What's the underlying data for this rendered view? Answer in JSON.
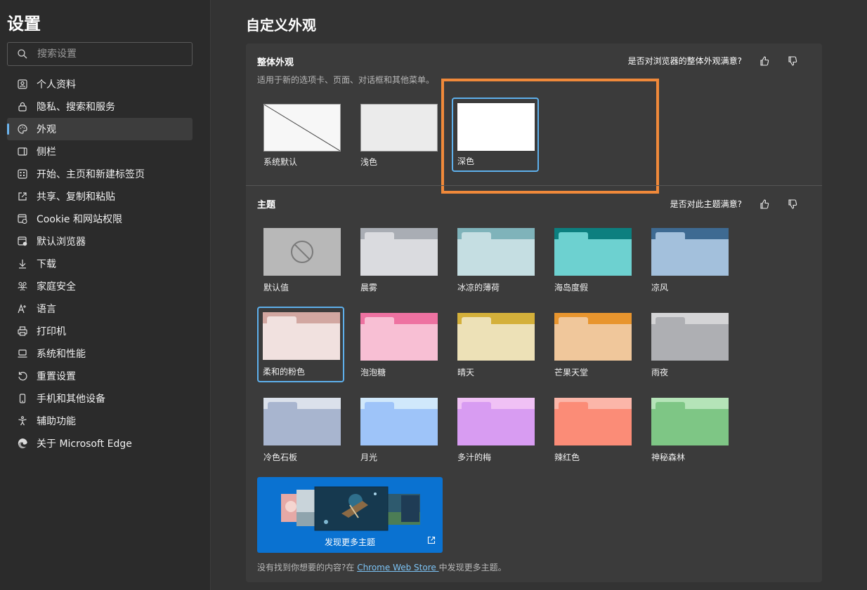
{
  "sidebar": {
    "title": "设置",
    "search_placeholder": "搜索设置",
    "items": [
      {
        "label": "个人资料",
        "icon": "profile-icon"
      },
      {
        "label": "隐私、搜索和服务",
        "icon": "lock-icon"
      },
      {
        "label": "外观",
        "icon": "palette-icon",
        "active": true
      },
      {
        "label": "侧栏",
        "icon": "sidebar-icon"
      },
      {
        "label": "开始、主页和新建标签页",
        "icon": "home-grid-icon"
      },
      {
        "label": "共享、复制和粘贴",
        "icon": "share-icon"
      },
      {
        "label": "Cookie 和网站权限",
        "icon": "cookie-icon"
      },
      {
        "label": "默认浏览器",
        "icon": "browser-icon"
      },
      {
        "label": "下载",
        "icon": "download-icon"
      },
      {
        "label": "家庭安全",
        "icon": "family-icon"
      },
      {
        "label": "语言",
        "icon": "language-icon"
      },
      {
        "label": "打印机",
        "icon": "printer-icon"
      },
      {
        "label": "系统和性能",
        "icon": "laptop-icon"
      },
      {
        "label": "重置设置",
        "icon": "reset-icon"
      },
      {
        "label": "手机和其他设备",
        "icon": "phone-icon"
      },
      {
        "label": "辅助功能",
        "icon": "accessibility-icon"
      },
      {
        "label": "关于 Microsoft Edge",
        "icon": "edge-logo-icon"
      }
    ]
  },
  "main": {
    "title": "自定义外观",
    "overall": {
      "title": "整体外观",
      "description": "适用于新的选项卡、页面、对话框和其他菜单。",
      "feedback": "是否对浏览器的整体外观满意?",
      "modes": [
        {
          "label": "系统默认"
        },
        {
          "label": "浅色"
        },
        {
          "label": "深色",
          "selected": true
        }
      ]
    },
    "themes": {
      "title": "主题",
      "feedback": "是否对此主题满意?",
      "items": [
        {
          "label": "默认值",
          "bar": "#b8b8b8",
          "body": "#b8b8b8",
          "tab": "#b8b8b8"
        },
        {
          "label": "晨雾",
          "bar": "#a9adb4",
          "body": "#dadbdf",
          "tab": "#dadbdf"
        },
        {
          "label": "冰凉的薄荷",
          "bar": "#7fb3ba",
          "body": "#c5dee2",
          "tab": "#c5dee2"
        },
        {
          "label": "海岛度假",
          "bar": "#0c7f7f",
          "body": "#6dd1d0",
          "tab": "#6dd1d0"
        },
        {
          "label": "凉风",
          "bar": "#3e6a92",
          "body": "#a3c0dc",
          "tab": "#a3c0dc"
        },
        {
          "label": "柔和的粉色",
          "bar": "#d2a7a1",
          "body": "#f1e1df",
          "tab": "#f1e1df",
          "selected": true
        },
        {
          "label": "泡泡糖",
          "bar": "#ee72a1",
          "body": "#f8bfd4",
          "tab": "#f8bfd4"
        },
        {
          "label": "晴天",
          "bar": "#d4b03a",
          "body": "#ede1b7",
          "tab": "#ede1b7"
        },
        {
          "label": "芒果天堂",
          "bar": "#e8952e",
          "body": "#f0c79b",
          "tab": "#f0c79b"
        },
        {
          "label": "雨夜",
          "bar": "#d4d4d6",
          "body": "#aeafb3",
          "tab": "#aeafb3"
        },
        {
          "label": "冷色石板",
          "bar": "#dbe1eb",
          "body": "#a8b5cf",
          "tab": "#a8b5cf"
        },
        {
          "label": "月光",
          "bar": "#d0e8fb",
          "body": "#9ec4f9",
          "tab": "#9ec4f9"
        },
        {
          "label": "多汁的梅",
          "bar": "#f0c1f5",
          "body": "#d89cf2",
          "tab": "#d89cf2"
        },
        {
          "label": "辣红色",
          "bar": "#fbb6a9",
          "body": "#fb8c77",
          "tab": "#fb8c77"
        },
        {
          "label": "神秘森林",
          "bar": "#b5e4b8",
          "body": "#7ec685",
          "tab": "#7ec685"
        }
      ],
      "discover_label": "发现更多主题"
    },
    "footer": {
      "prefix": "没有找到你想要的内容?在 ",
      "link": "Chrome Web Store ",
      "suffix": "中发现更多主题。"
    }
  },
  "colors": {
    "accent": "#5eb0ec",
    "highlight": "#f0893a",
    "discover_bg": "#0a72d1"
  }
}
